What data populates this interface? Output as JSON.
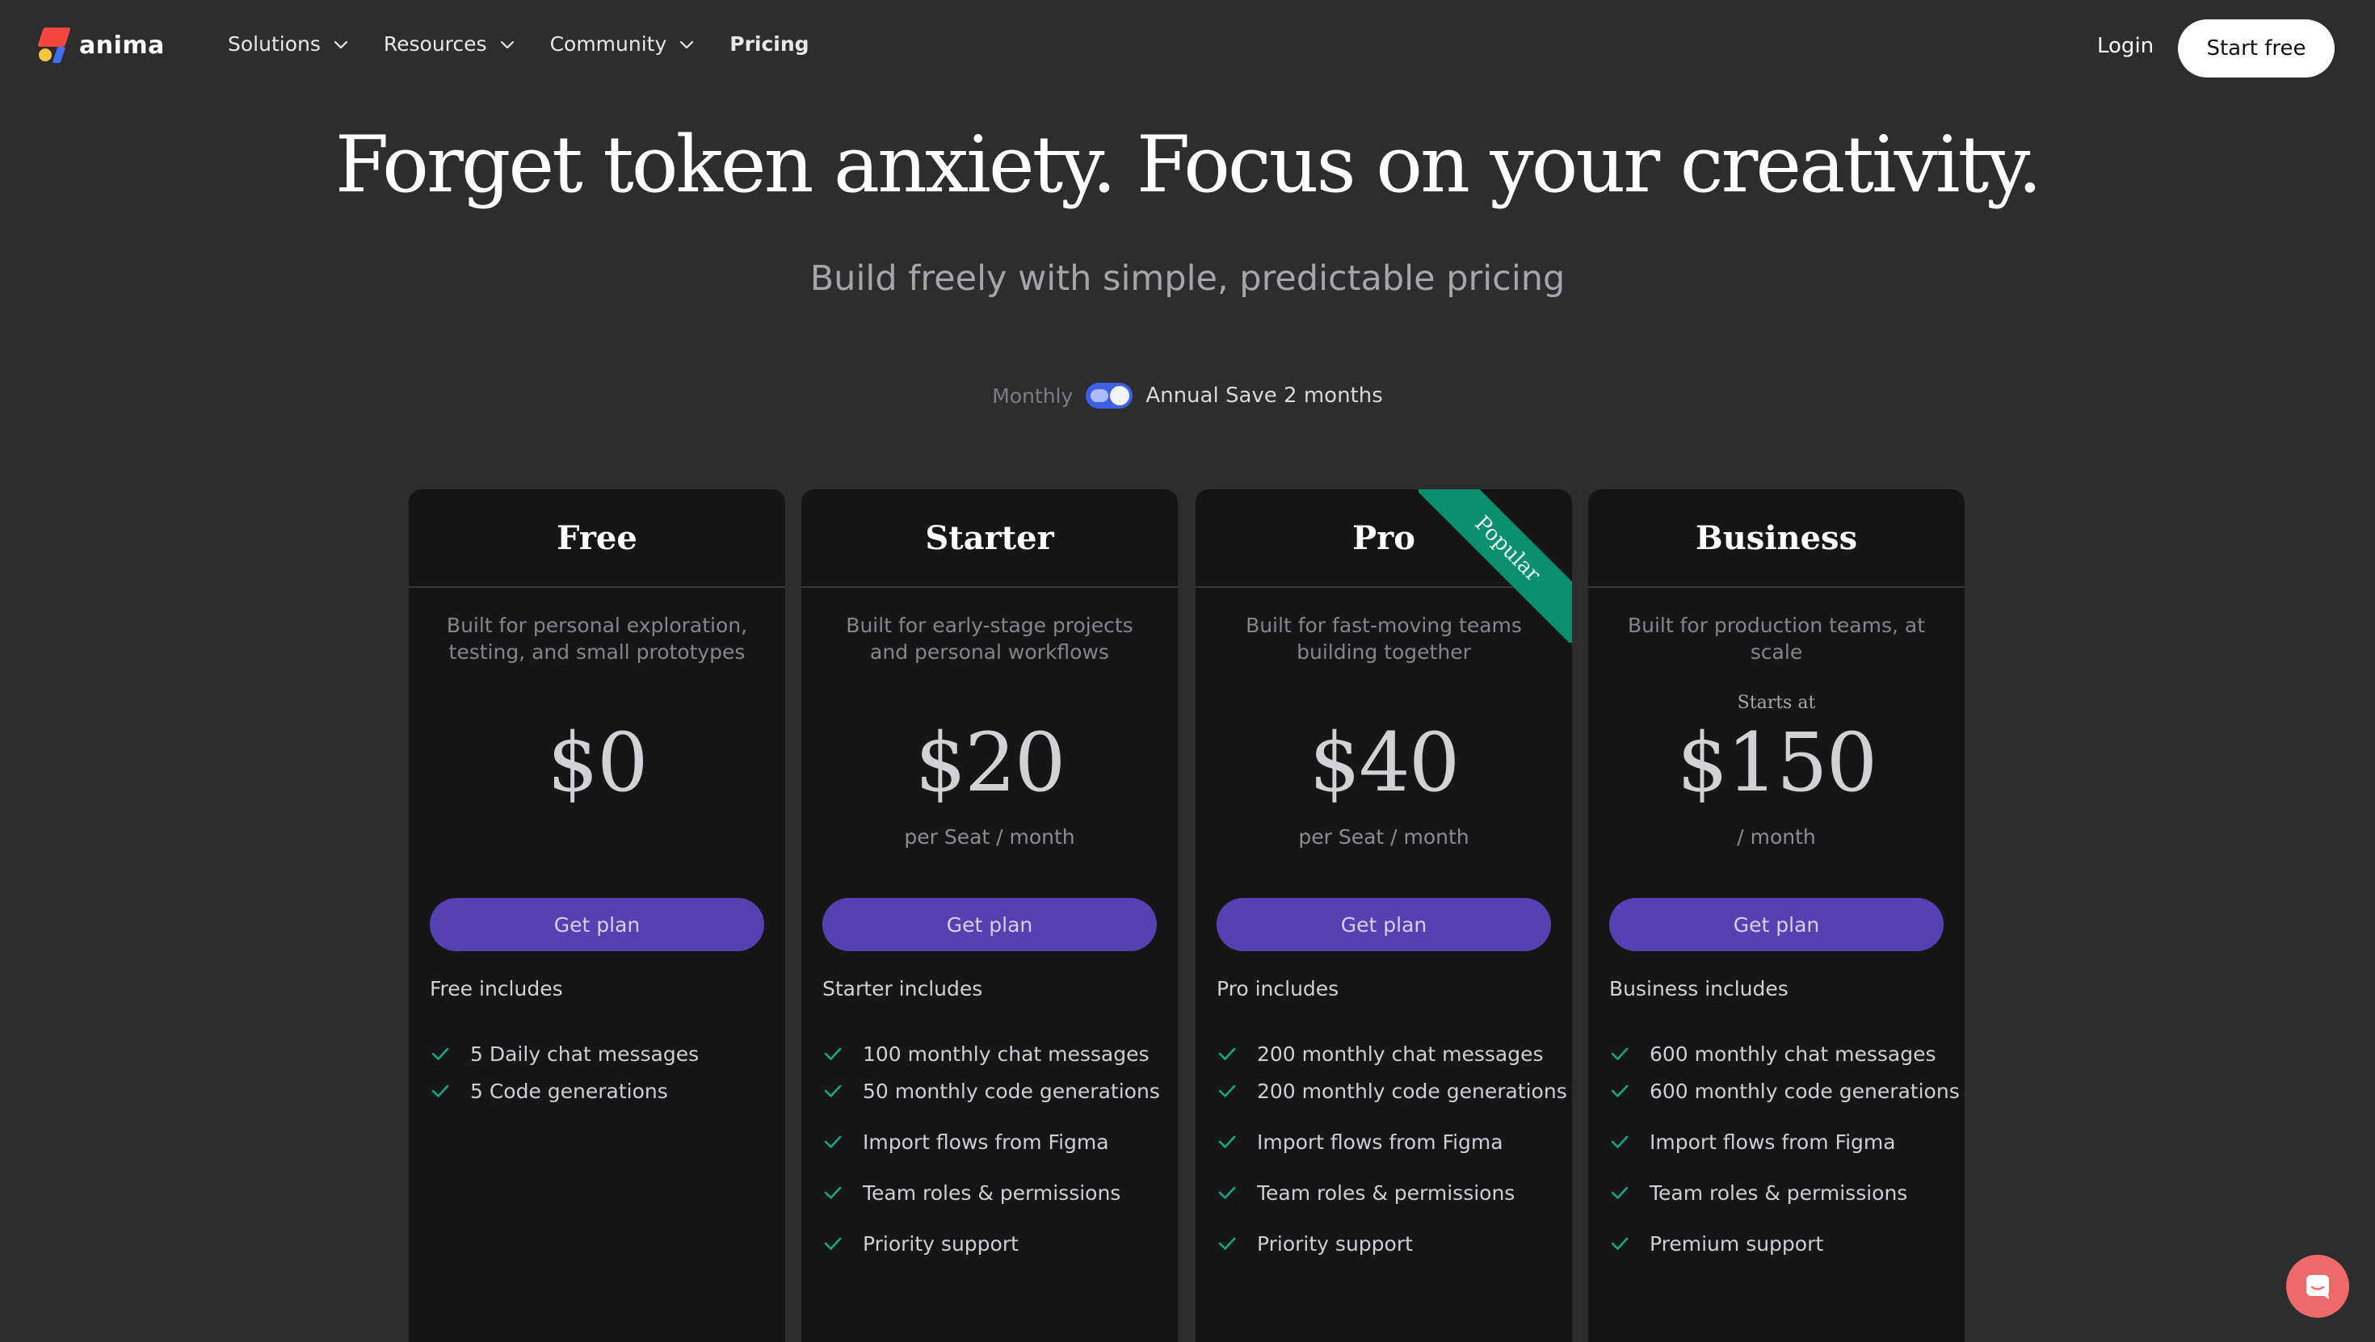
{
  "nav": {
    "logo_text": "anima",
    "items": [
      {
        "label": "Solutions",
        "dropdown": true
      },
      {
        "label": "Resources",
        "dropdown": true
      },
      {
        "label": "Community",
        "dropdown": true
      },
      {
        "label": "Pricing",
        "dropdown": false
      }
    ],
    "login_label": "Login",
    "cta_label": "Start free"
  },
  "hero": {
    "title": "Forget token anxiety. Focus on your creativity.",
    "subtitle": "Build freely with simple, predictable pricing"
  },
  "billing": {
    "monthly_label": "Monthly",
    "annual_label": "Annual Save 2 months",
    "selected": "Annual"
  },
  "plans": [
    {
      "name": "Free",
      "description": "Built for personal exploration, testing, and small prototypes",
      "starts_at": "",
      "price": "$0",
      "period": "",
      "button": "Get plan",
      "includes_title": "Free includes",
      "features": [
        "5 Daily chat messages",
        "5 Code generations"
      ]
    },
    {
      "name": "Starter",
      "description": "Built for early-stage projects and personal workflows",
      "starts_at": "",
      "price": "$20",
      "period": "per Seat / month",
      "button": "Get plan",
      "includes_title": "Starter includes",
      "features": [
        "100 monthly chat messages",
        "50 monthly code generations",
        "Import flows from Figma",
        "Team roles & permissions",
        "Priority support"
      ]
    },
    {
      "name": "Pro",
      "description": "Built for fast-moving teams building together",
      "starts_at": "",
      "price": "$40",
      "period": "per Seat / month",
      "button": "Get plan",
      "includes_title": "Pro includes",
      "badge": "Popular",
      "features": [
        "200 monthly chat messages",
        "200 monthly code generations",
        "Import flows from Figma",
        "Team roles & permissions",
        "Priority support"
      ]
    },
    {
      "name": "Business",
      "description": "Built for production teams, at scale",
      "starts_at": "Starts at",
      "price": "$150",
      "period": "/ month",
      "button": "Get plan",
      "includes_title": "Business includes",
      "features": [
        "600 monthly chat messages",
        "600 monthly code generations",
        "Import flows from Figma",
        "Team roles & permissions",
        "Premium support"
      ]
    }
  ],
  "colors": {
    "background": "#2d2d2e",
    "card": "#161616",
    "button": "#5641b3",
    "toggle": "#3d60e6",
    "check": "#12a882",
    "ribbon": "#0c8f6e",
    "chat_bubble": "#ee6a6a"
  },
  "icons": {
    "chevron": "chevron-down-icon",
    "check": "check-icon",
    "chat": "chat-icon"
  }
}
